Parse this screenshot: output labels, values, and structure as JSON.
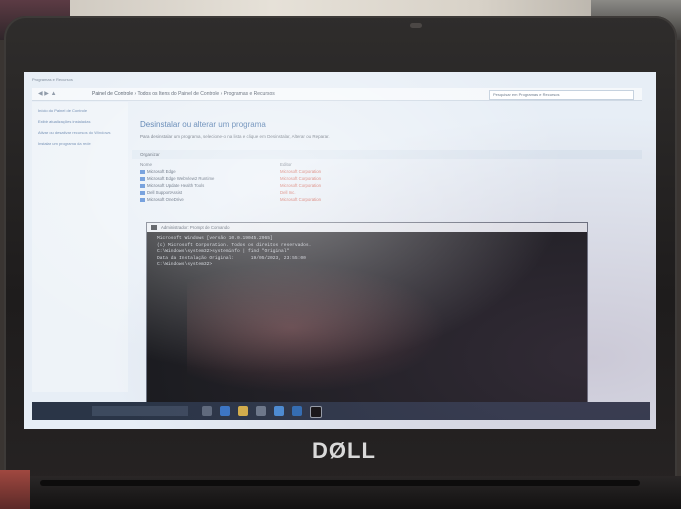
{
  "explorer": {
    "title": "Programas e Recursos",
    "path": "Painel de Controle  ›  Todos os Itens do Painel de Controle  ›  Programas e Recursos",
    "search_placeholder": "Pesquisar em Programas e Recursos",
    "leftnav": [
      "Início do Painel de Controle",
      "Exibir atualizações instaladas",
      "Ativar ou desativar recursos do Windows",
      "Instalar um programa da rede"
    ],
    "heading": "Desinstalar ou alterar um programa",
    "subheading": "Para desinstalar um programa, selecione-o na lista e clique em Desinstalar, Alterar ou Reparar.",
    "organize": "Organizar",
    "col_name": "Nome",
    "col_publisher": "Editor",
    "programs": [
      {
        "name": "Microsoft Edge",
        "publisher": "Microsoft Corporation"
      },
      {
        "name": "Microsoft Edge WebView2 Runtime",
        "publisher": "Microsoft Corporation"
      },
      {
        "name": "Microsoft Update Health Tools",
        "publisher": "Microsoft Corporation"
      },
      {
        "name": "Dell SupportAssist",
        "publisher": "Dell Inc."
      },
      {
        "name": "Microsoft OneDrive",
        "publisher": "Microsoft Corporation"
      }
    ]
  },
  "terminal": {
    "title": "Administrador: Prompt de Comando",
    "lines": [
      "Microsoft Windows [versão 10.0.19045.2965]",
      "(c) Microsoft Corporation. Todos os direitos reservados.",
      "",
      "C:\\Windows\\system32>systeminfo | find \"Original\"",
      "Data da Instalação Original:      19/05/2023, 23:55:00",
      "",
      "C:\\Windows\\system32>"
    ]
  },
  "laptop": {
    "brand": "DØLL"
  }
}
